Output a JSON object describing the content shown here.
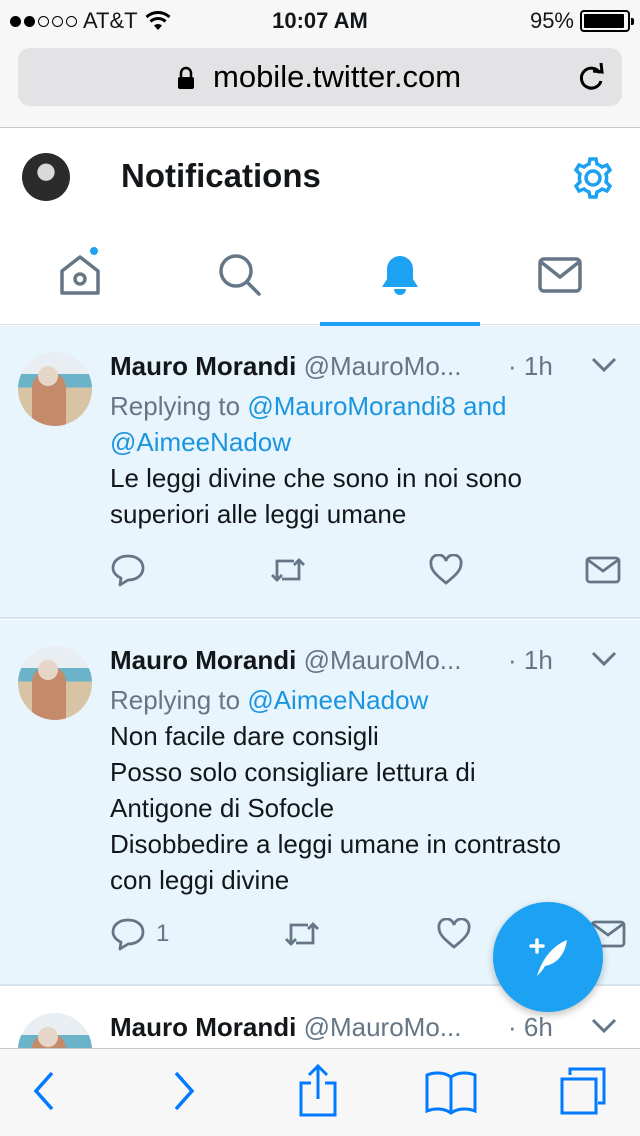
{
  "status_bar": {
    "carrier": "AT&T",
    "signal_bars_filled": 2,
    "signal_bars_total": 5,
    "time": "10:07 AM",
    "battery_percent": "95%",
    "battery_level": 0.95
  },
  "browser": {
    "url": "mobile.twitter.com"
  },
  "header": {
    "title": "Notifications"
  },
  "tabs": [
    {
      "name": "home",
      "icon": "home-icon",
      "active": false,
      "has_dot": true
    },
    {
      "name": "search",
      "icon": "search-icon",
      "active": false,
      "has_dot": false
    },
    {
      "name": "notifications",
      "icon": "bell-icon",
      "active": true,
      "has_dot": false
    },
    {
      "name": "messages",
      "icon": "envelope-icon",
      "active": false,
      "has_dot": false
    }
  ],
  "tweets": [
    {
      "name": "Mauro Morandi",
      "handle": "@MauroMo...",
      "time": "· 1h",
      "replying_prefix": "Replying to ",
      "replying_mention_1": "@MauroMorandi8 and",
      "replying_mention_2": "@AimeeNadow",
      "lines": [
        "Le leggi divine che sono in noi sono",
        "superiori alle leggi umane"
      ],
      "reply_count": ""
    },
    {
      "name": "Mauro Morandi",
      "handle": "@MauroMo...",
      "time": "· 1h",
      "replying_prefix": "Replying to ",
      "replying_mention_1": "@AimeeNadow",
      "lines": [
        "Non facile dare consigli",
        "Posso solo consigliare lettura di",
        "Antigone di Sofocle",
        "Disobbedire a leggi umane in contrasto",
        "con leggi divine"
      ],
      "reply_count": "1"
    },
    {
      "name": "Mauro Morandi",
      "handle": "@MauroMo...",
      "time": "· 6h"
    }
  ],
  "colors": {
    "accent": "#1da1f2",
    "mention": "#1b95e0",
    "highlight_bg": "#e8f5fd",
    "secondary_text": "#657786",
    "ios_blue": "#007aff"
  }
}
